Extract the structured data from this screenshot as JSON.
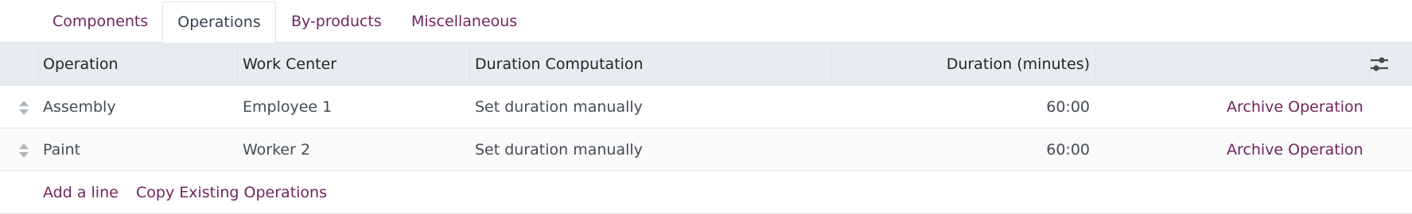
{
  "tabs": [
    {
      "label": "Components"
    },
    {
      "label": "Operations",
      "active": true
    },
    {
      "label": "By-products"
    },
    {
      "label": "Miscellaneous"
    }
  ],
  "table": {
    "columns": [
      "Operation",
      "Work Center",
      "Duration Computation",
      "Duration (minutes)"
    ],
    "rows": [
      {
        "operation": "Assembly",
        "work_center": "Employee 1",
        "duration_computation": "Set duration manually",
        "duration": "60:00",
        "action": "Archive Operation"
      },
      {
        "operation": "Paint",
        "work_center": "Worker 2",
        "duration_computation": "Set duration manually",
        "duration": "60:00",
        "action": "Archive Operation"
      }
    ]
  },
  "footer": {
    "add_line": "Add a line",
    "copy_operations": "Copy Existing Operations"
  },
  "icons": {
    "handle": "drag-handle-icon",
    "settings": "optional-columns-settings-icon"
  },
  "colors": {
    "accent": "#71245f",
    "header_bg": "#e9ecef",
    "border": "#dee2e6"
  }
}
